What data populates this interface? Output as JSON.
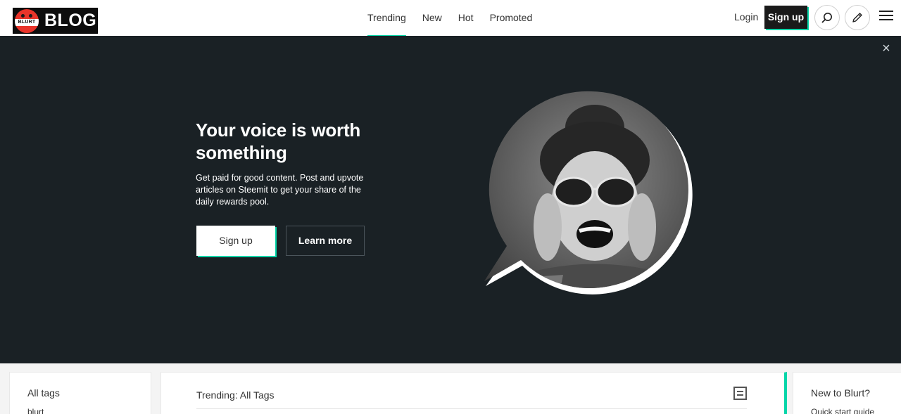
{
  "header": {
    "logo_badge_text": "BLURT",
    "logo_text": "BLOG",
    "nav": [
      {
        "label": "Trending",
        "active": true
      },
      {
        "label": "New",
        "active": false
      },
      {
        "label": "Hot",
        "active": false
      },
      {
        "label": "Promoted",
        "active": false
      }
    ],
    "login_label": "Login",
    "signup_label": "Sign up",
    "search_icon": "search-icon",
    "edit_icon": "pencil-icon",
    "menu_icon": "hamburger-menu-icon"
  },
  "hero": {
    "close_icon": "close-icon",
    "title": "Your voice is worth something",
    "subtitle": "Get paid for good content. Post and upvote articles on Steemit to get your share of the daily rewards pool.",
    "signup_label": "Sign up",
    "learn_more_label": "Learn more"
  },
  "sidebar_left": {
    "title": "All tags",
    "items": [
      "blurt"
    ]
  },
  "main": {
    "title": "Trending: All Tags",
    "toggle_icon": "layout-toggle-icon"
  },
  "sidebar_right": {
    "title": "New to Blurt?",
    "items": [
      "Quick start guide"
    ]
  },
  "colors": {
    "accent": "#06d6a9",
    "hero_bg": "#1a2125",
    "header_bg": "#ffffff",
    "logo_red": "#e8342a"
  }
}
